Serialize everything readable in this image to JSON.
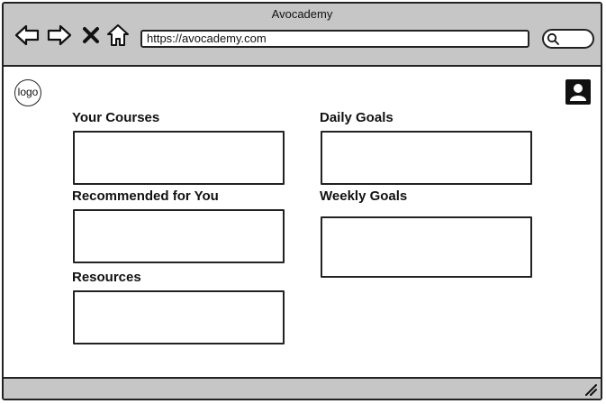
{
  "window": {
    "title": "Avocademy"
  },
  "toolbar": {
    "back_icon": "arrow-left-icon",
    "forward_icon": "arrow-right-icon",
    "close_icon": "close-icon",
    "home_icon": "home-icon",
    "url": "https://avocademy.com",
    "search_icon": "search-icon"
  },
  "header": {
    "logo_label": "logo",
    "profile_icon": "user-icon"
  },
  "sections": {
    "your_courses": "Your Courses",
    "recommended": "Recommended for You",
    "resources": "Resources",
    "daily_goals": "Daily Goals",
    "weekly_goals": "Weekly Goals"
  },
  "colors": {
    "chrome": "#c6c6c6",
    "stroke": "#222222",
    "background": "#ffffff"
  }
}
